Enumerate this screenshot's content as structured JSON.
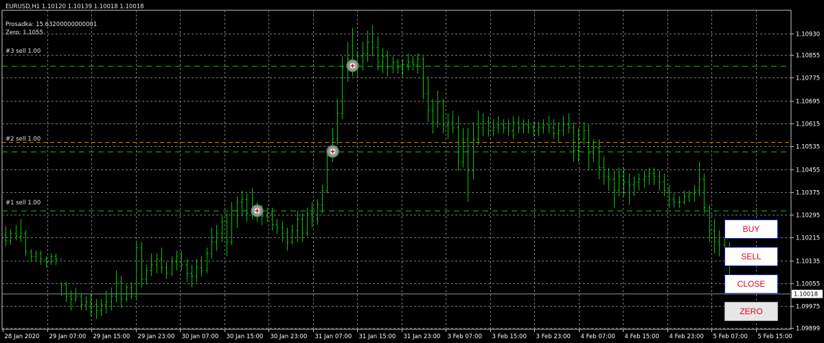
{
  "header": {
    "symbol_line": "EURUSD,H1  1.10120 1.10139 1.10018 1.10018",
    "drawdown_line": "Prosadka: 15.63200000000001",
    "zero_line": "Zero: 1.1055"
  },
  "order_labels": {
    "sell3": "#3 sell 1.00",
    "sell2_overlap": "#2 sell 1.00",
    "sell1": "#1 sell 1.00"
  },
  "buttons": {
    "buy": "BUY",
    "sell": "SELL",
    "close": "CLOSE",
    "zero": "ZERO"
  },
  "colors": {
    "background": "#000000",
    "grid": "#7a7a7a",
    "candle": "#00c800",
    "sell_line": "#00c800",
    "zero_line": "#e08000",
    "bid_line": "#8090a0",
    "axis_text": "#ffffff",
    "button_text": "#e0001b",
    "button_border": "#1a2bd6"
  },
  "chart_data": {
    "type": "ohlc",
    "symbol": "EURUSD",
    "timeframe": "H1",
    "ylim": [
      1.09899,
      1.10968
    ],
    "y_ticks": [
      "1.10930",
      "1.10855",
      "1.10775",
      "1.10695",
      "1.10615",
      "1.10535",
      "1.10455",
      "1.10375",
      "1.10295",
      "1.10215",
      "1.10135",
      "1.10055",
      "1.09975",
      "1.09899"
    ],
    "x_ticks": [
      "28 Jan 2020",
      "29 Jan 07:00",
      "29 Jan 15:00",
      "29 Jan 23:00",
      "30 Jan 07:00",
      "30 Jan 15:00",
      "30 Jan 23:00",
      "31 Jan 07:00",
      "31 Jan 15:00",
      "31 Jan 23:00",
      "3 Feb 07:00",
      "3 Feb 15:00",
      "3 Feb 23:00",
      "4 Feb 07:00",
      "4 Feb 15:00",
      "4 Feb 23:00",
      "5 Feb 07:00",
      "5 Feb 15:00"
    ],
    "current_price": "1.10018",
    "order_levels": [
      {
        "label": "#3 sell 1.00",
        "price": 1.10817
      },
      {
        "label": "#2 sell 1.00",
        "price": 1.10517
      },
      {
        "label": "#1 sell 1.00",
        "price": 1.10309
      },
      {
        "label": "zero",
        "price": 1.1055
      }
    ],
    "entries": [
      {
        "bar": 50,
        "price": 1.10309
      },
      {
        "bar": 65,
        "price": 1.10517
      },
      {
        "bar": 69,
        "price": 1.10817
      }
    ],
    "bars": [
      [
        1.10225,
        1.10255,
        1.10185,
        1.10205
      ],
      [
        1.10205,
        1.10245,
        1.1019,
        1.1023
      ],
      [
        1.1023,
        1.1026,
        1.10205,
        1.1022
      ],
      [
        1.1022,
        1.1028,
        1.102,
        1.1023
      ],
      [
        1.1023,
        1.1024,
        1.1015,
        1.10165
      ],
      [
        1.10165,
        1.10175,
        1.1013,
        1.1015
      ],
      [
        1.1015,
        1.1017,
        1.1013,
        1.1016
      ],
      [
        1.1016,
        1.1017,
        1.1012,
        1.1014
      ],
      [
        1.1014,
        1.1015,
        1.1011,
        1.1013
      ],
      [
        1.1013,
        1.1016,
        1.1012,
        1.1015
      ],
      [
        1.1015,
        1.1016,
        1.1012,
        1.1014
      ],
      [
        1.1014,
        1.1006,
        1.1001,
        1.1005
      ],
      [
        1.1005,
        1.1006,
        1.0999,
        1.1001
      ],
      [
        1.1001,
        1.1003,
        1.0996,
        1.1
      ],
      [
        1.1,
        1.1004,
        1.0999,
        1.1001
      ],
      [
        1.1001,
        1.1002,
        1.0996,
        1.0998
      ],
      [
        1.0998,
        1.1001,
        1.0996,
        1.0999
      ],
      [
        1.0999,
        1.1002,
        1.0994,
        1.0998
      ],
      [
        1.0998,
        1.1,
        1.0993,
        1.0996
      ],
      [
        1.0996,
        1.1,
        1.0994,
        1.0998
      ],
      [
        1.0998,
        1.1003,
        1.0995,
        1.0999
      ],
      [
        1.0999,
        1.1004,
        1.0996,
        1.1001
      ],
      [
        1.1001,
        1.101,
        1.0999,
        1.1006
      ],
      [
        1.1006,
        1.1008,
        1.0997,
        1.1
      ],
      [
        1.1,
        1.1005,
        1.0999,
        1.1004
      ],
      [
        1.1004,
        1.1006,
        1.1,
        1.1001
      ],
      [
        1.1001,
        1.10205,
        1.1,
        1.1018
      ],
      [
        1.1018,
        1.102,
        1.1004,
        1.1007
      ],
      [
        1.1007,
        1.1012,
        1.1005,
        1.101
      ],
      [
        1.101,
        1.1016,
        1.1008,
        1.1012
      ],
      [
        1.1012,
        1.1016,
        1.1009,
        1.1014
      ],
      [
        1.1014,
        1.1018,
        1.1009,
        1.1011
      ],
      [
        1.1011,
        1.1013,
        1.1007,
        1.1009
      ],
      [
        1.1009,
        1.1015,
        1.1008,
        1.1013
      ],
      [
        1.1013,
        1.1017,
        1.101,
        1.1015
      ],
      [
        1.1015,
        1.1017,
        1.101,
        1.1012
      ],
      [
        1.1012,
        1.1014,
        1.1006,
        1.1009
      ],
      [
        1.1009,
        1.1012,
        1.1004,
        1.1008
      ],
      [
        1.1008,
        1.1014,
        1.1006,
        1.1011
      ],
      [
        1.1011,
        1.1015,
        1.1008,
        1.101
      ],
      [
        1.101,
        1.1018,
        1.1009,
        1.1016
      ],
      [
        1.1016,
        1.1025,
        1.1014,
        1.102
      ],
      [
        1.102,
        1.1026,
        1.1017,
        1.1023
      ],
      [
        1.1023,
        1.1029,
        1.102,
        1.1027
      ],
      [
        1.1027,
        1.103,
        1.1015,
        1.102
      ],
      [
        1.102,
        1.1034,
        1.1019,
        1.1031
      ],
      [
        1.1031,
        1.1036,
        1.1025,
        1.1034
      ],
      [
        1.1034,
        1.1038,
        1.1029,
        1.1035
      ],
      [
        1.1035,
        1.1037,
        1.1027,
        1.103
      ],
      [
        1.103,
        1.1039,
        1.1028,
        1.1032
      ],
      [
        1.1032,
        1.1034,
        1.1027,
        1.1031
      ],
      [
        1.1031,
        1.1033,
        1.1026,
        1.1029
      ],
      [
        1.1029,
        1.1032,
        1.1027,
        1.103
      ],
      [
        1.103,
        1.1032,
        1.1024,
        1.1026
      ],
      [
        1.1026,
        1.1028,
        1.1023,
        1.1025
      ],
      [
        1.1025,
        1.1027,
        1.102,
        1.1023
      ],
      [
        1.1023,
        1.1025,
        1.1017,
        1.102
      ],
      [
        1.102,
        1.1026,
        1.1019,
        1.1024
      ],
      [
        1.1024,
        1.1031,
        1.102,
        1.1028
      ],
      [
        1.1028,
        1.103,
        1.102,
        1.1023
      ],
      [
        1.1023,
        1.1032,
        1.1022,
        1.103
      ],
      [
        1.103,
        1.1034,
        1.1025,
        1.1028
      ],
      [
        1.1028,
        1.1035,
        1.1026,
        1.1033
      ],
      [
        1.1033,
        1.104,
        1.103,
        1.1038
      ],
      [
        1.1038,
        1.1052,
        1.1037,
        1.105
      ],
      [
        1.105,
        1.106,
        1.1048,
        1.1056
      ],
      [
        1.1056,
        1.107,
        1.1054,
        1.1065
      ],
      [
        1.1065,
        1.1085,
        1.1063,
        1.1081
      ],
      [
        1.1081,
        1.109,
        1.1076,
        1.1084
      ],
      [
        1.1084,
        1.1095,
        1.1078,
        1.1082
      ],
      [
        1.1082,
        1.1087,
        1.1078,
        1.1085
      ],
      [
        1.1085,
        1.109,
        1.108,
        1.1086
      ],
      [
        1.1086,
        1.1094,
        1.1083,
        1.109
      ],
      [
        1.109,
        1.1096,
        1.1085,
        1.1088
      ],
      [
        1.1088,
        1.1092,
        1.108,
        1.1083
      ],
      [
        1.1083,
        1.1088,
        1.1079,
        1.1085
      ],
      [
        1.1085,
        1.1087,
        1.1078,
        1.1081
      ],
      [
        1.1081,
        1.1085,
        1.1079,
        1.1083
      ],
      [
        1.1083,
        1.1084,
        1.1079,
        1.1081
      ],
      [
        1.1081,
        1.1084,
        1.1078,
        1.1082
      ],
      [
        1.1082,
        1.1086,
        1.108,
        1.1083
      ],
      [
        1.1083,
        1.1085,
        1.108,
        1.1082
      ],
      [
        1.1082,
        1.1086,
        1.1079,
        1.1084
      ],
      [
        1.1084,
        1.1085,
        1.107,
        1.1072
      ],
      [
        1.1072,
        1.1078,
        1.1062,
        1.1066
      ],
      [
        1.1066,
        1.107,
        1.1058,
        1.1062
      ],
      [
        1.1062,
        1.1073,
        1.106,
        1.1069
      ],
      [
        1.1069,
        1.107,
        1.1058,
        1.1061
      ],
      [
        1.1061,
        1.1065,
        1.1056,
        1.1062
      ],
      [
        1.1062,
        1.1066,
        1.1058,
        1.106
      ],
      [
        1.106,
        1.1064,
        1.1045,
        1.1048
      ],
      [
        1.1048,
        1.106,
        1.1046,
        1.1056
      ],
      [
        1.1056,
        1.106,
        1.1034,
        1.1045
      ],
      [
        1.1045,
        1.1062,
        1.1042,
        1.1056
      ],
      [
        1.1056,
        1.1066,
        1.1054,
        1.106
      ],
      [
        1.106,
        1.1065,
        1.1057,
        1.1062
      ],
      [
        1.1062,
        1.1064,
        1.1057,
        1.1059
      ],
      [
        1.1059,
        1.1063,
        1.1057,
        1.106
      ],
      [
        1.106,
        1.1064,
        1.1058,
        1.1061
      ],
      [
        1.1061,
        1.1063,
        1.1058,
        1.106
      ],
      [
        1.106,
        1.1063,
        1.1057,
        1.1059
      ],
      [
        1.1059,
        1.1064,
        1.1056,
        1.1062
      ],
      [
        1.1062,
        1.1064,
        1.1058,
        1.106
      ],
      [
        1.106,
        1.1063,
        1.1058,
        1.1061
      ],
      [
        1.1061,
        1.1063,
        1.1058,
        1.106
      ],
      [
        1.106,
        1.1062,
        1.1057,
        1.1059
      ],
      [
        1.1059,
        1.1062,
        1.1057,
        1.106
      ],
      [
        1.106,
        1.1063,
        1.1058,
        1.1061
      ],
      [
        1.1061,
        1.1064,
        1.1058,
        1.106
      ],
      [
        1.106,
        1.1063,
        1.1056,
        1.1058
      ],
      [
        1.1058,
        1.1062,
        1.1055,
        1.1059
      ],
      [
        1.1059,
        1.1064,
        1.1057,
        1.1061
      ],
      [
        1.1061,
        1.1065,
        1.1058,
        1.106
      ],
      [
        1.106,
        1.1062,
        1.1048,
        1.1052
      ],
      [
        1.1052,
        1.106,
        1.1048,
        1.1056
      ],
      [
        1.1056,
        1.1062,
        1.1054,
        1.1059
      ],
      [
        1.1059,
        1.1061,
        1.1045,
        1.1051
      ],
      [
        1.1051,
        1.1056,
        1.1048,
        1.1053
      ],
      [
        1.1053,
        1.1056,
        1.1042,
        1.1046
      ],
      [
        1.1046,
        1.105,
        1.104,
        1.1043
      ],
      [
        1.1043,
        1.1046,
        1.1038,
        1.1042
      ],
      [
        1.1042,
        1.1045,
        1.1032,
        1.1038
      ],
      [
        1.1038,
        1.1046,
        1.1036,
        1.1043
      ],
      [
        1.1043,
        1.1046,
        1.1036,
        1.1041
      ],
      [
        1.1041,
        1.1044,
        1.1033,
        1.104
      ],
      [
        1.104,
        1.1043,
        1.1036,
        1.1041
      ],
      [
        1.1041,
        1.1044,
        1.1038,
        1.1042
      ],
      [
        1.1042,
        1.1045,
        1.1039,
        1.1043
      ],
      [
        1.1043,
        1.1046,
        1.104,
        1.1044
      ],
      [
        1.1044,
        1.1046,
        1.104,
        1.1043
      ],
      [
        1.1043,
        1.1045,
        1.1038,
        1.1041
      ],
      [
        1.1041,
        1.1044,
        1.1036,
        1.1038
      ],
      [
        1.1038,
        1.104,
        1.1032,
        1.1035
      ],
      [
        1.1035,
        1.1037,
        1.1032,
        1.1034
      ],
      [
        1.1034,
        1.1036,
        1.1032,
        1.1034
      ],
      [
        1.1034,
        1.1038,
        1.1033,
        1.1036
      ],
      [
        1.1036,
        1.1038,
        1.1034,
        1.1037
      ],
      [
        1.1037,
        1.104,
        1.1034,
        1.1038
      ],
      [
        1.1038,
        1.1048,
        1.1036,
        1.1042
      ],
      [
        1.1042,
        1.1044,
        1.103,
        1.1032
      ],
      [
        1.1032,
        1.1033,
        1.102,
        1.1024
      ],
      [
        1.1024,
        1.1028,
        1.1016,
        1.102
      ],
      [
        1.102,
        1.1024,
        1.1015,
        1.1019
      ],
      [
        1.1019,
        1.1022,
        1.1013,
        1.1015
      ],
      [
        1.1015,
        1.102,
        1.1008,
        1.1012
      ]
    ]
  }
}
